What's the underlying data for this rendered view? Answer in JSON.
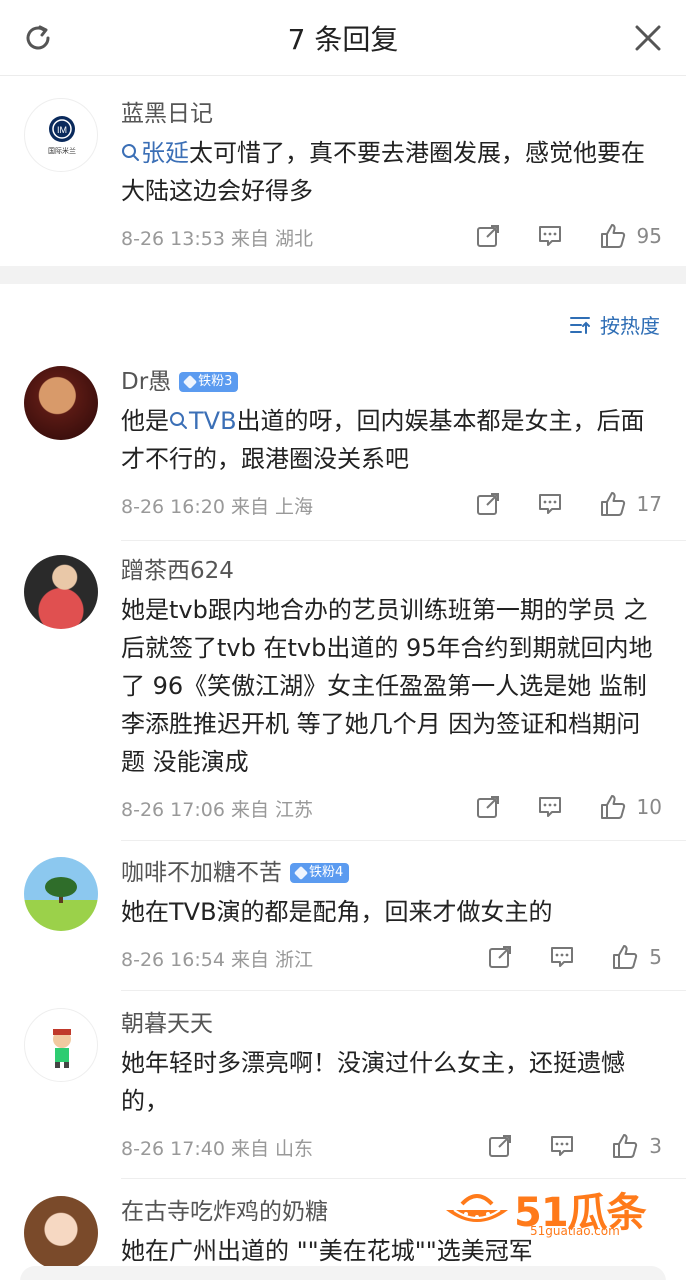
{
  "header": {
    "title": "7 条回复",
    "refresh_icon": "refresh-icon",
    "close_icon": "close-icon"
  },
  "root_comment": {
    "username": "蓝黑日记",
    "avatar_caption": "国际米兰",
    "topic": "张延",
    "text": "太可惜了，真不要去港圈发展，感觉他要在大陆这边会好得多",
    "time": "8-26 13:53 来自 湖北",
    "likes": "95"
  },
  "sort": {
    "label": "按热度"
  },
  "replies": [
    {
      "username": "Dr愚",
      "badge": "铁粉3",
      "text_before": "他是",
      "topic": "TVB",
      "text_after": "出道的呀，回内娱基本都是女主，后面才不行的，跟港圈没关系吧",
      "time": "8-26 16:20 来自 上海",
      "likes": "17"
    },
    {
      "username": "蹭茶西624",
      "text": "她是tvb跟内地合办的艺员训练班第一期的学员 之后就签了tvb 在tvb出道的 95年合约到期就回内地了 96《笑傲江湖》女主任盈盈第一人选是她 监制李添胜推迟开机 等了她几个月 因为签证和档期问题 没能演成",
      "time": "8-26 17:06 来自 江苏",
      "likes": "10"
    },
    {
      "username": "咖啡不加糖不苦",
      "badge": "铁粉4",
      "text": "她在TVB演的都是配角，回来才做女主的",
      "time": "8-26 16:54 来自 浙江",
      "likes": "5"
    },
    {
      "username": "朝暮天天",
      "text": "她年轻时多漂亮啊！没演过什么女主，还挺遗憾的，",
      "time": "8-26 17:40 来自 山东",
      "likes": "3"
    },
    {
      "username": "在古寺吃炸鸡的奶糖",
      "text": "她在广州出道的 \"\"美在花城\"\"选美冠军"
    }
  ],
  "watermark": {
    "text": "51瓜条",
    "url": "51guatiao.com"
  },
  "colors": {
    "link": "#3b6fb6",
    "badge": "#5b9bf0",
    "watermark": "#ff7a1a"
  }
}
